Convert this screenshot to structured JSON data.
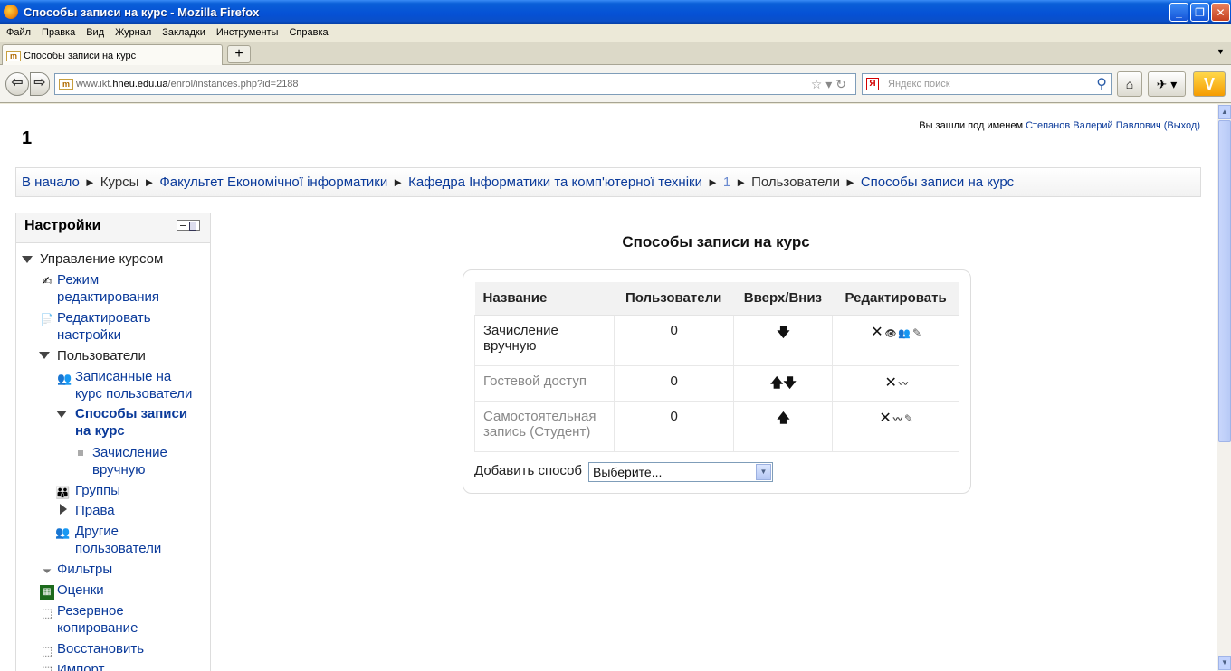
{
  "window": {
    "title": "Способы записи на курс - Mozilla Firefox",
    "controls": [
      "_",
      "❐",
      "✕"
    ]
  },
  "menu": [
    "Файл",
    "Правка",
    "Вид",
    "Журнал",
    "Закладки",
    "Инструменты",
    "Справка"
  ],
  "tab": {
    "label": "Способы записи на курс",
    "favicon": "m"
  },
  "nav": {
    "url_prefix": "www.ikt.",
    "url_domain": "hneu.edu.ua",
    "url_path": "/enrol/instances.php?id=2188",
    "search_placeholder": "Яндекс поиск"
  },
  "page": {
    "course_title": "1",
    "login_prefix": "Вы зашли под именем ",
    "login_user": "Степанов Валерий Павлович",
    "login_logout": "(Выход)",
    "breadcrumb": [
      "В начало",
      "Курсы",
      "Факультет Економічної інформатики",
      "Кафедра Інформатики та комп'ютерної техніки",
      "1",
      "Пользователи",
      "Способы записи на курс"
    ],
    "breadcrumb_sep": "►"
  },
  "settings": {
    "title": "Настройки",
    "course_admin": "Управление курсом",
    "edit_mode_1": "Режим",
    "edit_mode_2": "редактирования",
    "edit_settings_1": "Редактировать",
    "edit_settings_2": "настройки",
    "users": "Пользователи",
    "enrolled_1": "Записанные на",
    "enrolled_2": "курс пользователи",
    "enrol_methods_1": "Способы записи",
    "enrol_methods_2": "на курс",
    "manual_1": "Зачисление",
    "manual_2": "вручную",
    "groups": "Группы",
    "permissions": "Права",
    "other_users_1": "Другие",
    "other_users_2": "пользователи",
    "filters": "Фильтры",
    "grades": "Оценки",
    "backup_1": "Резервное",
    "backup_2": "копирование",
    "restore": "Восстановить",
    "import": "Импорт"
  },
  "main": {
    "heading": "Способы записи на курс",
    "columns": {
      "name": "Название",
      "users": "Пользователи",
      "updown": "Вверх/Вниз",
      "edit": "Редактировать"
    },
    "rows": [
      {
        "name_1": "Зачисление",
        "name_2": "вручную",
        "users": "0",
        "arrows": "🡇",
        "edit_icons": [
          "✕",
          "👁",
          "👥",
          "✎"
        ]
      },
      {
        "name_1": "Гостевой доступ",
        "name_2": "",
        "users": "0",
        "arrows": "🡅🡇",
        "edit_icons": [
          "✕",
          "〰"
        ]
      },
      {
        "name_1": "Самостоятельная",
        "name_2": "запись (Студент)",
        "users": "0",
        "arrows": "🡅",
        "edit_icons": [
          "✕",
          "〰",
          "✎"
        ]
      }
    ],
    "add_label": "Добавить способ",
    "add_select_value": "Выберите..."
  }
}
